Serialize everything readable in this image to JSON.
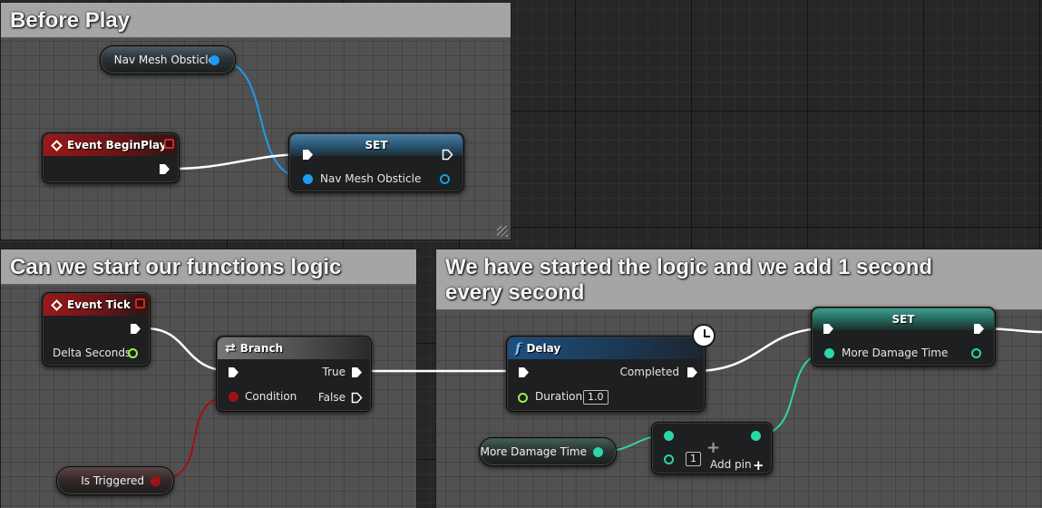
{
  "comments": {
    "before_play": "Before Play",
    "functions_logic": "Can we start our functions logic",
    "started_logic": "We have started the logic and we add 1 second every second"
  },
  "nodes": {
    "nav_mesh_var": "Nav Mesh Obsticle",
    "event_begin_play": "Event BeginPlay",
    "set_nav": {
      "title": "SET",
      "pin": "Nav Mesh Obsticle"
    },
    "event_tick": {
      "title": "Event Tick",
      "pin": "Delta Seconds"
    },
    "branch": {
      "title": "Branch",
      "true_pin": "True",
      "false_pin": "False",
      "condition_pin": "Condition"
    },
    "is_triggered_var": "Is Triggered",
    "delay": {
      "title": "Delay",
      "completed_pin": "Completed",
      "duration_pin": "Duration",
      "duration_value": "1.0"
    },
    "set_damage": {
      "title": "SET",
      "pin": "More Damage Time"
    },
    "more_damage_var": "More Damage Time",
    "add_node": {
      "value": "1",
      "add_pin_label": "Add pin"
    }
  },
  "icons": {
    "event": "diamond-icon",
    "branch": "branch-icon",
    "function": "function-icon",
    "latent": "clock-icon"
  },
  "colors": {
    "object_pin": "#1a9cf0",
    "float_pin": "#2bd6a8",
    "bool_pin": "#a01212",
    "delta_pin": "#9bf04a",
    "exec_wire": "#ffffff",
    "event_header": "#9a1818"
  }
}
